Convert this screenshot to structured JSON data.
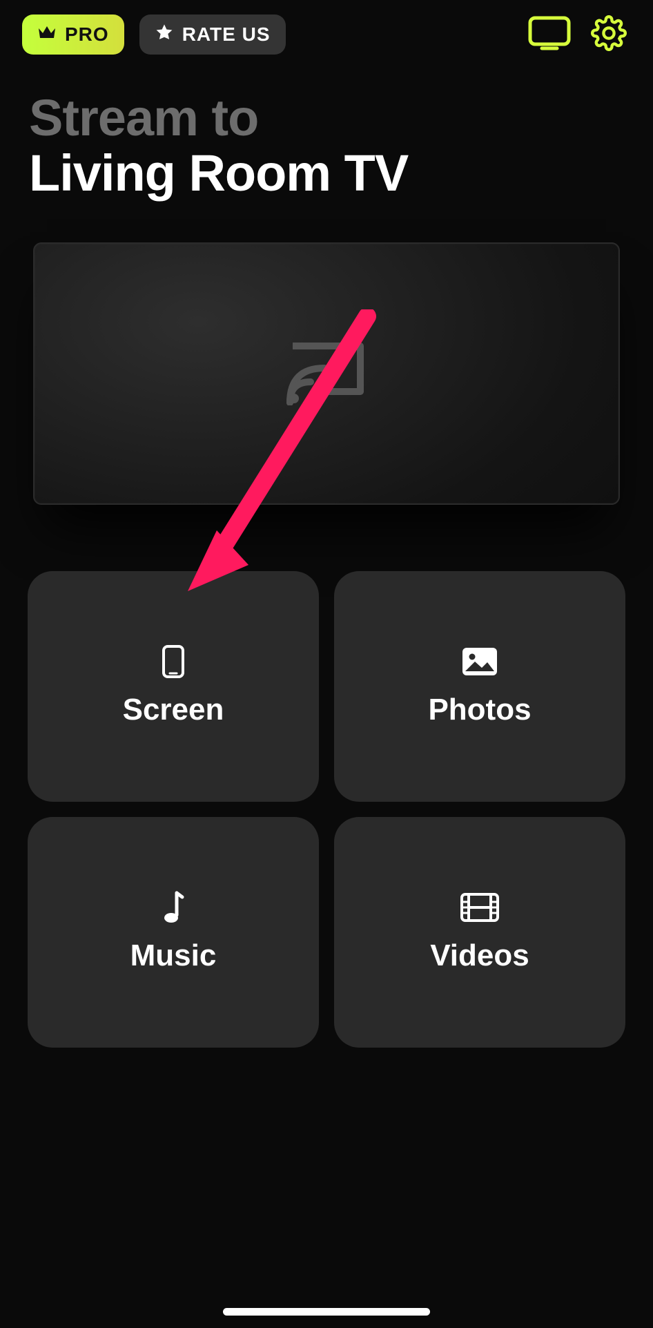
{
  "topbar": {
    "pro_label": "PRO",
    "rate_label": "RATE US"
  },
  "heading": {
    "prefix": "Stream to",
    "target": "Living Room TV"
  },
  "tiles": {
    "screen": "Screen",
    "photos": "Photos",
    "music": "Music",
    "videos": "Videos"
  },
  "colors": {
    "accent": "#d7ff3c",
    "annotation_arrow": "#ff1a5e"
  }
}
